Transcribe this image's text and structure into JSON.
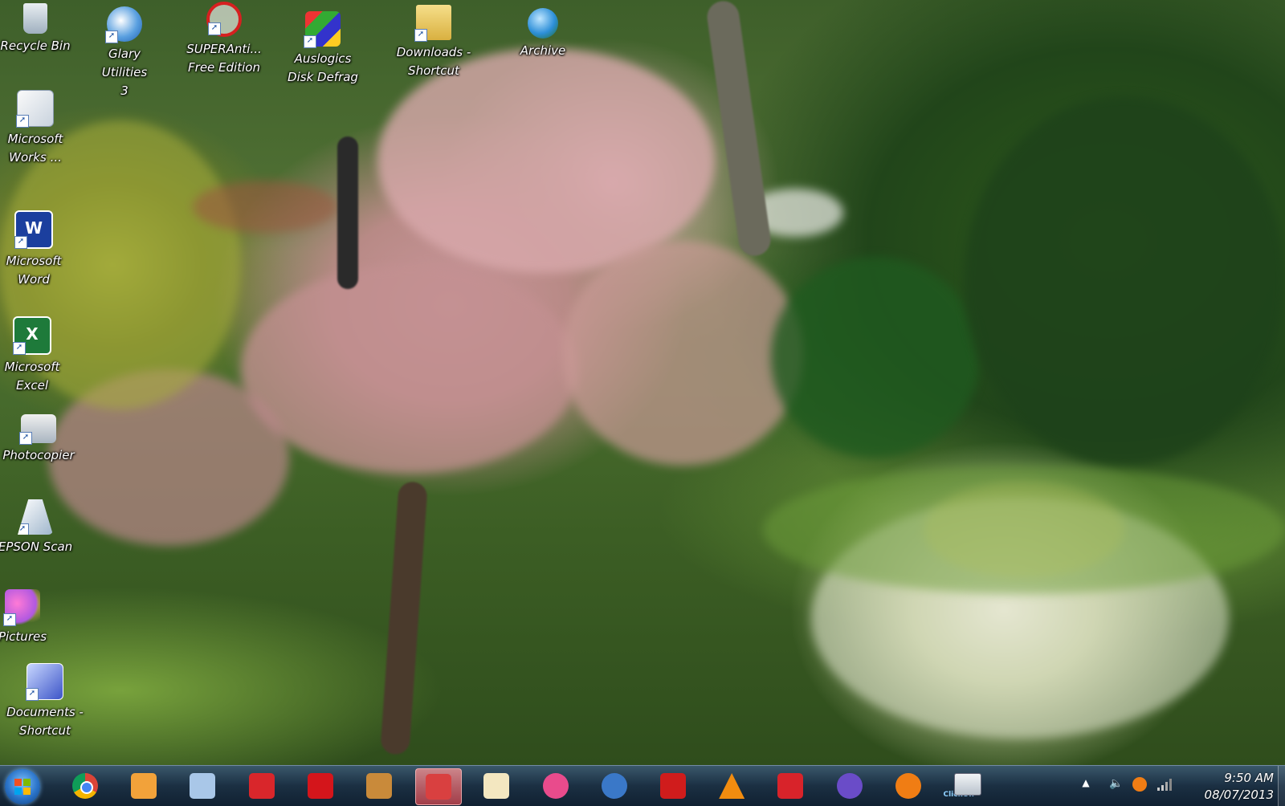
{
  "desktop_icons": [
    {
      "id": "recycle-bin",
      "label": "Recycle Bin",
      "icon": "recycle-bin-icon"
    },
    {
      "id": "glary-utilities",
      "label": "Glary Utilities\n3",
      "icon": "glary-utilities-icon"
    },
    {
      "id": "superantispyware",
      "label": "SUPERAnti...\nFree Edition",
      "icon": "superantispyware-icon"
    },
    {
      "id": "auslogics-defrag",
      "label": "Auslogics\nDisk Defrag",
      "icon": "auslogics-defrag-icon"
    },
    {
      "id": "downloads-shortcut",
      "label": "Downloads -\nShortcut",
      "icon": "downloads-folder-icon"
    },
    {
      "id": "archive",
      "label": "Archive",
      "icon": "archive-globe-icon"
    },
    {
      "id": "microsoft-works",
      "label": "Microsoft\nWorks ...",
      "icon": "microsoft-works-icon"
    },
    {
      "id": "microsoft-word",
      "label": "Microsoft\nWord",
      "icon": "microsoft-word-icon"
    },
    {
      "id": "microsoft-excel",
      "label": "Microsoft\nExcel",
      "icon": "microsoft-excel-icon"
    },
    {
      "id": "photocopier",
      "label": "Photocopier",
      "icon": "photocopier-icon"
    },
    {
      "id": "epson-scan",
      "label": "EPSON Scan",
      "icon": "epson-scan-icon"
    },
    {
      "id": "pictures",
      "label": "Pictures",
      "icon": "pictures-butterfly-icon"
    },
    {
      "id": "documents-shortcut",
      "label": "Documents -\nShortcut",
      "icon": "documents-icon"
    }
  ],
  "taskbar": {
    "start_icon": "windows-start-icon",
    "pinned": [
      {
        "id": "chrome",
        "icon": "chrome-icon",
        "color": "#e8453c"
      },
      {
        "id": "windows-live",
        "icon": "windows-live-butterfly-icon",
        "color": "#f2a23a"
      },
      {
        "id": "notepad",
        "icon": "notepad-icon",
        "color": "#a9c7e8"
      },
      {
        "id": "fastone-capture",
        "icon": "fastone-capture-icon",
        "color": "#d9262b"
      },
      {
        "id": "paint-splat",
        "icon": "paint-splat-icon",
        "color": "#d4151b"
      },
      {
        "id": "paint-palette",
        "icon": "paint-palette-icon",
        "color": "#c98a3a"
      },
      {
        "id": "snipping-tool",
        "icon": "snipping-tool-icon",
        "color": "#d94040"
      },
      {
        "id": "mail",
        "icon": "mail-envelope-icon",
        "color": "#f3e7c0"
      },
      {
        "id": "balloon-app",
        "icon": "hot-air-balloon-icon",
        "color": "#e94b8c"
      },
      {
        "id": "s-app",
        "icon": "s-circle-icon",
        "color": "#3a78c8"
      },
      {
        "id": "adobe-reader",
        "icon": "adobe-reader-icon",
        "color": "#d01c1c"
      },
      {
        "id": "vlc",
        "icon": "vlc-cone-icon",
        "color": "#f28c0f"
      },
      {
        "id": "security-app",
        "icon": "shield-app-icon",
        "color": "#d8232a"
      },
      {
        "id": "media-ring",
        "icon": "colour-ring-icon",
        "color": "#6a4cc8"
      },
      {
        "id": "avast",
        "icon": "avast-icon",
        "color": "#f07d14"
      },
      {
        "id": "clickoff",
        "icon": "clickoff-ok-icon",
        "color": "#cfd6dd",
        "label": "ClickOff"
      }
    ],
    "tray": {
      "show_hidden_icon": "up-triangle-icon",
      "volume_icon": "speaker-icon",
      "app_icon": "orange-circle-icon",
      "network_icon": "signal-bars-icon"
    },
    "clock": {
      "time": "9:50 AM",
      "date": "08/07/2013"
    }
  }
}
